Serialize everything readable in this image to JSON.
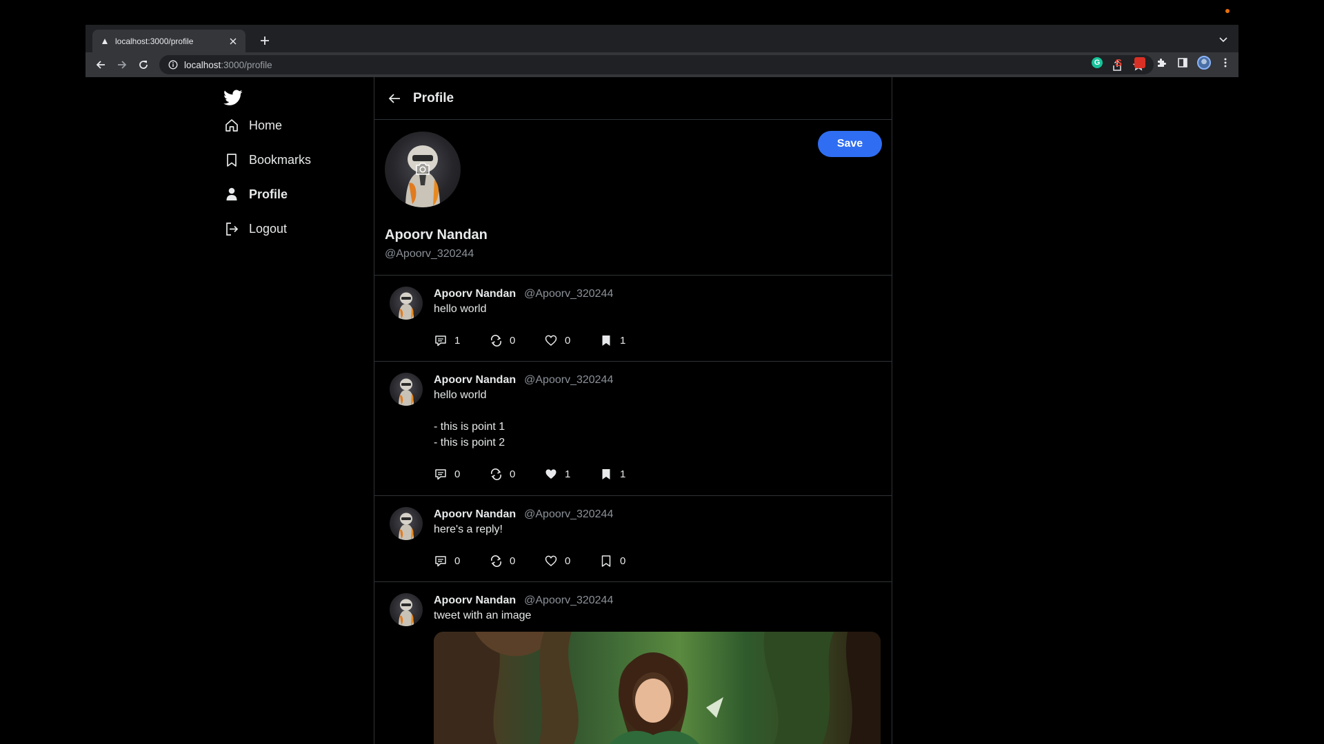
{
  "browser": {
    "tab_title": "localhost:3000/profile",
    "url_host": "localhost",
    "url_path": ":3000/profile",
    "extension_g_letter": "G",
    "extension_s_letter": "S"
  },
  "sidebar": {
    "items": [
      {
        "label": "Home",
        "icon": "home-icon"
      },
      {
        "label": "Bookmarks",
        "icon": "bookmark-icon"
      },
      {
        "label": "Profile",
        "icon": "person-icon",
        "active": true
      },
      {
        "label": "Logout",
        "icon": "logout-icon"
      }
    ]
  },
  "header": {
    "title": "Profile"
  },
  "profile": {
    "name": "Apoorv Nandan",
    "handle": "@Apoorv_320244",
    "save_label": "Save"
  },
  "tweets": [
    {
      "name": "Apoorv Nandan",
      "handle": "@Apoorv_320244",
      "lines": [
        "hello world"
      ],
      "replies": "1",
      "retweets": "0",
      "likes": "0",
      "liked": false,
      "bookmarks": "1",
      "bookmarked": true
    },
    {
      "name": "Apoorv Nandan",
      "handle": "@Apoorv_320244",
      "lines": [
        "hello world",
        "",
        "- this is point 1",
        "- this is point 2"
      ],
      "replies": "0",
      "retweets": "0",
      "likes": "1",
      "liked": true,
      "bookmarks": "1",
      "bookmarked": true
    },
    {
      "name": "Apoorv Nandan",
      "handle": "@Apoorv_320244",
      "lines": [
        "here's a reply!"
      ],
      "replies": "0",
      "retweets": "0",
      "likes": "0",
      "liked": false,
      "bookmarks": "0",
      "bookmarked": false
    },
    {
      "name": "Apoorv Nandan",
      "handle": "@Apoorv_320244",
      "lines": [
        "tweet with an image"
      ],
      "has_image": true
    }
  ],
  "colors": {
    "accent": "#2f6ef2",
    "twitter_blue": "#ffffff",
    "background": "#000000",
    "border": "#2f3336",
    "muted_text": "#8b9198"
  }
}
